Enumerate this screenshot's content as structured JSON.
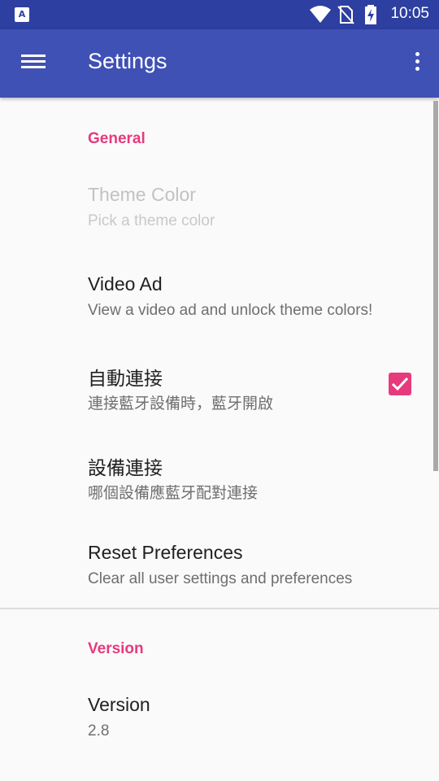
{
  "status_bar": {
    "time": "10:05",
    "app_icon_letter": "A"
  },
  "app_bar": {
    "title": "Settings",
    "menu_icon": "hamburger-menu-icon",
    "overflow_icon": "more-vert-icon",
    "color": "#3f51b5"
  },
  "sections": {
    "general": {
      "header": "General"
    },
    "version": {
      "header": "Version"
    }
  },
  "prefs": {
    "theme_color": {
      "title": "Theme Color",
      "summary": "Pick a theme color",
      "enabled": false
    },
    "video_ad": {
      "title": "Video Ad",
      "summary": "View a video ad and unlock theme colors!"
    },
    "auto_connect": {
      "title": "自動連接",
      "summary": "連接藍牙設備時，藍牙開啟",
      "checked": true
    },
    "device_connect": {
      "title": "設備連接",
      "summary": "哪個設備應藍牙配對連接"
    },
    "reset": {
      "title": "Reset Preferences",
      "summary": "Clear all user settings and preferences"
    },
    "version": {
      "title": "Version",
      "summary": "2.8"
    }
  },
  "colors": {
    "accent": "#e63a7d",
    "primary": "#3f51b5",
    "primary_dark": "#2d3fa0"
  }
}
